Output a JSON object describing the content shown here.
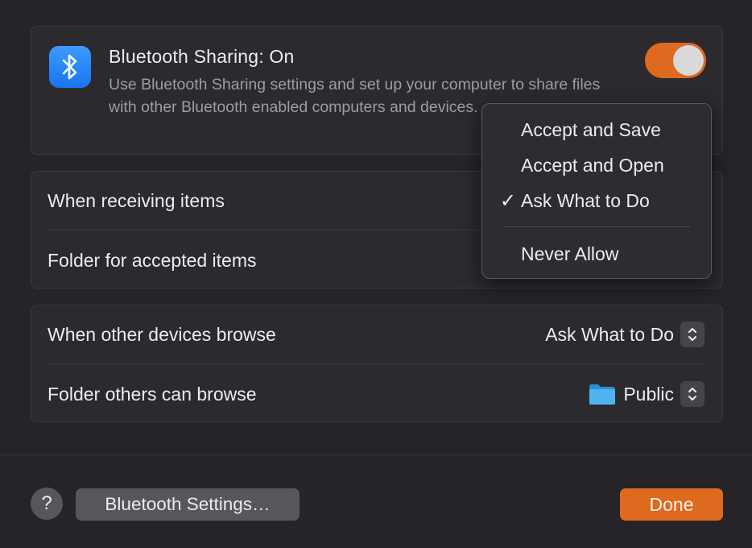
{
  "header": {
    "title": "Bluetooth Sharing: On",
    "description": "Use Bluetooth Sharing settings and set up your computer to share files with other Bluetooth enabled computers and devices.",
    "icon": "bluetooth-icon",
    "toggle_on": true
  },
  "receiving": {
    "when_receiving_label": "When receiving items",
    "folder_accepted_label": "Folder for accepted items"
  },
  "browse": {
    "when_browse_label": "When other devices browse",
    "when_browse_value": "Ask What to Do",
    "folder_browse_label": "Folder others can browse",
    "folder_browse_value": "Public"
  },
  "menu": {
    "items": [
      {
        "label": "Accept and Save",
        "checked": false
      },
      {
        "label": "Accept and Open",
        "checked": false
      },
      {
        "label": "Ask What to Do",
        "checked": true
      },
      {
        "label": "Never Allow",
        "checked": false
      }
    ],
    "check_glyph": "✓"
  },
  "footer": {
    "help_label": "?",
    "bluetooth_settings_label": "Bluetooth Settings…",
    "done_label": "Done"
  },
  "colors": {
    "accent": "#de6a1f",
    "bluetooth_blue": "#1a74f0",
    "folder_blue": "#3fa7e8"
  }
}
